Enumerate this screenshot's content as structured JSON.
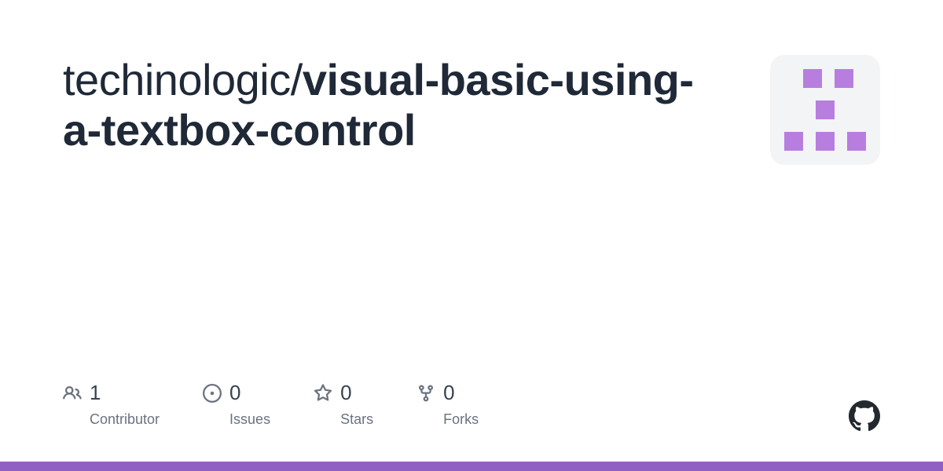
{
  "repo": {
    "owner": "techinologic",
    "separator": "/",
    "name": "visual-basic-using-a-textbox-control"
  },
  "stats": {
    "contributors": {
      "count": "1",
      "label": "Contributor"
    },
    "issues": {
      "count": "0",
      "label": "Issues"
    },
    "stars": {
      "count": "0",
      "label": "Stars"
    },
    "forks": {
      "count": "0",
      "label": "Forks"
    }
  },
  "colors": {
    "accent": "#9061c2",
    "identicon": "#b77ee0"
  }
}
